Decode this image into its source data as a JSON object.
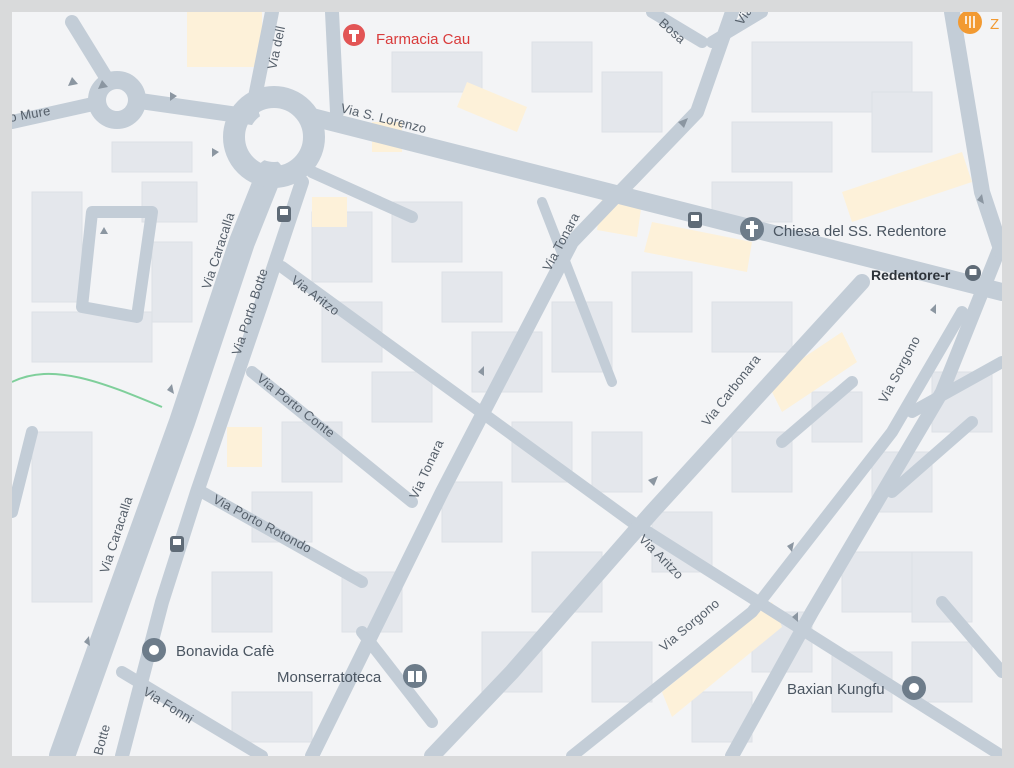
{
  "map": {
    "streets": [
      {
        "id": "via-s-lorenzo",
        "label": "Via S. Lorenzo"
      },
      {
        "id": "via-tonara-north",
        "label": "Via Tonara"
      },
      {
        "id": "via-tonara-south",
        "label": "Via Tonara"
      },
      {
        "id": "via-aritzo-west",
        "label": "Via Aritzo"
      },
      {
        "id": "via-aritzo-east",
        "label": "Via Aritzo"
      },
      {
        "id": "via-porto-conte",
        "label": "Via Porto Conte"
      },
      {
        "id": "via-porto-rotondo",
        "label": "Via Porto Rotondo"
      },
      {
        "id": "via-porto-botte",
        "label": "Via Porto Botte"
      },
      {
        "id": "via-caracalla-north",
        "label": "Via Caracalla"
      },
      {
        "id": "via-caracalla-south",
        "label": "Via Caracalla"
      },
      {
        "id": "via-carbonara",
        "label": "Via Carbonara"
      },
      {
        "id": "via-sorgono-north",
        "label": "Via Sorgono"
      },
      {
        "id": "via-sorgono-south",
        "label": "Via Sorgono"
      },
      {
        "id": "via-fonni",
        "label": "Via Fonni"
      },
      {
        "id": "via-bosa",
        "label": "Bosa"
      },
      {
        "id": "via-mure",
        "label": "o Mure"
      },
      {
        "id": "via-dell",
        "label": "Via dell"
      },
      {
        "id": "botte-bottom",
        "label": "Botte"
      },
      {
        "id": "via-top",
        "label": "Via"
      }
    ],
    "pois": [
      {
        "id": "farmacia-cau",
        "label": "Farmacia Cau",
        "icon": "pharmacy-icon",
        "color": "#e25555"
      },
      {
        "id": "chiesa-redentore",
        "label": "Chiesa del SS. Redentore",
        "icon": "church-icon",
        "color": "#6d7c8a"
      },
      {
        "id": "bonavida-cafe",
        "label": "Bonavida Cafè",
        "icon": "place-pin-icon",
        "color": "#6d7c8a"
      },
      {
        "id": "monserratoteca",
        "label": "Monserratoteca",
        "icon": "library-icon",
        "color": "#6d7c8a"
      },
      {
        "id": "baxian-kungfu",
        "label": "Baxian Kungfu",
        "icon": "place-pin-icon",
        "color": "#6d7c8a"
      },
      {
        "id": "restaurant-z",
        "label": "Z",
        "icon": "restaurant-icon",
        "color": "#f29a32"
      }
    ],
    "places": [
      {
        "id": "redentore-stop",
        "label": "Redentore-r",
        "icon": "transit-icon"
      }
    ],
    "colors": {
      "background": "#f3f4f6",
      "road": "#c3cdd7",
      "building": "#e4e7ec",
      "building_highlight": "#fdf1d9",
      "park_line": "#7fcf9b"
    }
  }
}
